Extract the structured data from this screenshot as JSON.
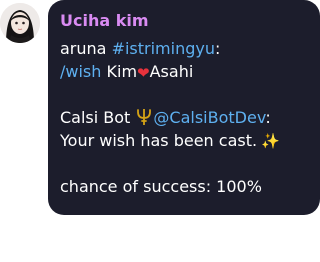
{
  "message": {
    "sender": "Uciha kim",
    "lines": {
      "l1_user": "aruna",
      "l1_tag": "#istrimingyu",
      "l1_suffix": ":",
      "l2_cmd": "/wish",
      "l2_a": "Kim",
      "l2_heart": "❤",
      "l2_b": "Asahi",
      "l3_bot": "Calsi Bot",
      "l3_bot_icon": "trident-icon",
      "l3_handle": "@CalsiBotDev",
      "l3_suffix": ":",
      "l4_text": "Your wish has been cast.",
      "l4_sparkle": "✨",
      "l5_text": "chance of success: 100%"
    }
  },
  "colors": {
    "bubble_bg": "#1c1d2c",
    "sender_name": "#d98bf2",
    "link": "#5eb0f0",
    "text": "#ffffff"
  }
}
